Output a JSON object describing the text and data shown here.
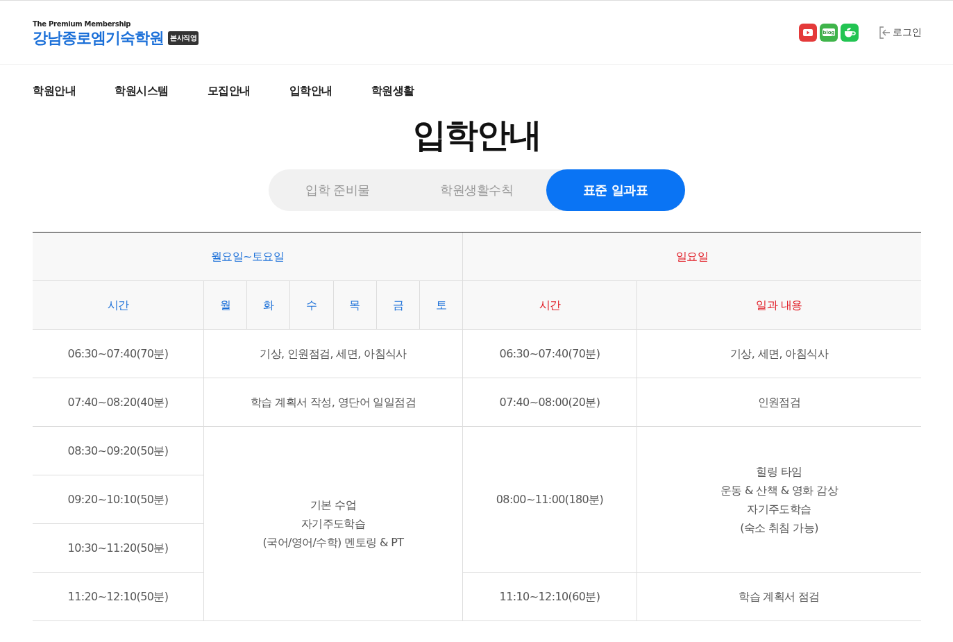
{
  "header": {
    "tagline": "The Premium Membership",
    "logo": "강남종로엠기숙학원",
    "badge": "본사직영",
    "sns": [
      {
        "kind": "video"
      },
      {
        "kind": "blog",
        "label": "blog"
      },
      {
        "kind": "cafe"
      }
    ],
    "login": "로그인"
  },
  "nav": [
    {
      "label": "학원안내"
    },
    {
      "label": "학원시스템"
    },
    {
      "label": "모집안내"
    },
    {
      "label": "입학안내"
    },
    {
      "label": "학원생활"
    }
  ],
  "page_title": "입학안내",
  "tabs": [
    {
      "label": "입학 준비물",
      "selected": false
    },
    {
      "label": "학원생활수칙",
      "selected": false
    },
    {
      "label": "표준 일과표",
      "selected": true
    }
  ],
  "schedule": {
    "groups": [
      {
        "title": "월요일~토요일",
        "kind": "weekday",
        "columns": [
          "시간",
          "월",
          "화",
          "수",
          "목",
          "금",
          "토"
        ],
        "blocks": [
          {
            "times": [
              "06:30~07:40(70분)"
            ],
            "activity": "기상, 인원점검, 세면, 아침식사"
          },
          {
            "times": [
              "07:40~08:20(40분)"
            ],
            "activity": "학습 계획서 작성, 영단어 일일점검"
          },
          {
            "times": [
              "08:30~09:20(50분)",
              "09:20~10:10(50분)",
              "10:30~11:20(50분)",
              "11:20~12:10(50분)"
            ],
            "activity": "기본 수업\n자기주도학습\n(국어/영어/수학) 멘토링 & PT"
          }
        ]
      },
      {
        "title": "일요일",
        "kind": "sunday",
        "columns": [
          "시간",
          "일과 내용"
        ],
        "blocks": [
          {
            "times": [
              "06:30~07:40(70분)"
            ],
            "activity": "기상, 세면, 아침식사"
          },
          {
            "times": [
              "07:40~08:00(20분)"
            ],
            "activity": "인원점검"
          },
          {
            "times": [
              "08:00~11:00(180분)"
            ],
            "activity": "힐링 타임\n운동 & 산책 & 영화 감상\n자기주도학습\n(숙소 취침 가능)"
          },
          {
            "times": [
              "11:10~12:10(60분)"
            ],
            "activity": "학습 계획서 점검"
          }
        ]
      }
    ]
  }
}
